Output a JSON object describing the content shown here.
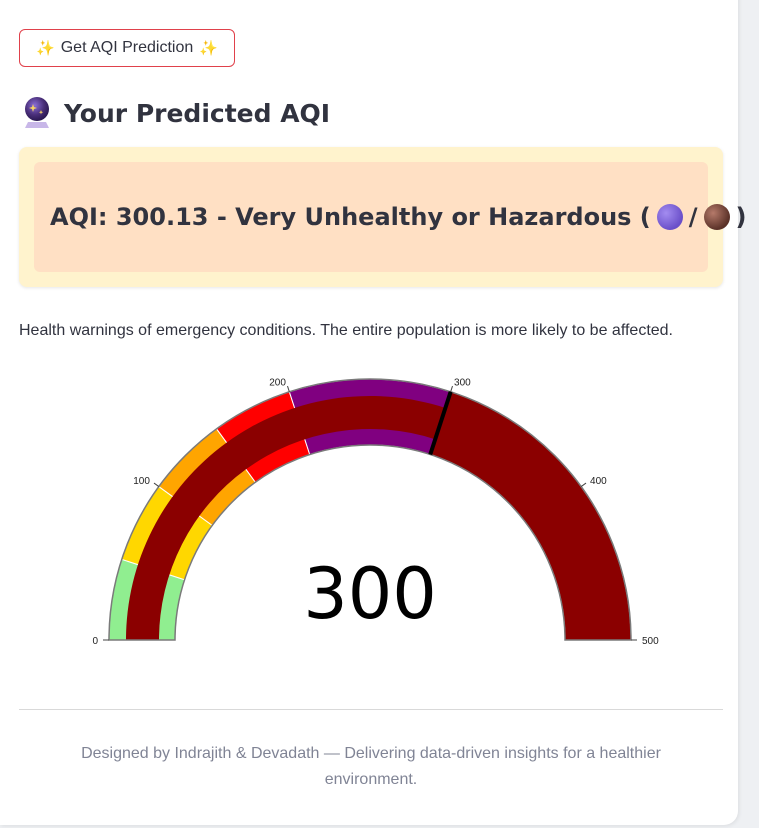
{
  "predict_button": {
    "label": "Get AQI Prediction",
    "icon": "sparkles-icon"
  },
  "heading": {
    "icon": "crystal-ball-icon",
    "text": "Your Predicted AQI"
  },
  "result": {
    "prefix": "AQI: 300.13 - Very Unhealthy or Hazardous (",
    "separator": "/",
    "suffix": ")",
    "colors": [
      "#7b61d9",
      "#6e3c30"
    ]
  },
  "warning_text": "Health warnings of emergency conditions. The entire population is more likely to be affected.",
  "chart_data": {
    "type": "gauge",
    "value": 300,
    "value_label": "300",
    "range": [
      0,
      500
    ],
    "ticks": [
      0,
      100,
      200,
      300,
      400,
      500
    ],
    "tick_labels": [
      "0",
      "100",
      "200",
      "300",
      "400",
      "500"
    ],
    "bar_color": "#8b0000",
    "steps": [
      {
        "range": [
          0,
          50
        ],
        "color": "#90ee90"
      },
      {
        "range": [
          50,
          100
        ],
        "color": "#ffd700"
      },
      {
        "range": [
          100,
          150
        ],
        "color": "#ffa500"
      },
      {
        "range": [
          150,
          200
        ],
        "color": "#ff0000"
      },
      {
        "range": [
          200,
          300
        ],
        "color": "#800080"
      },
      {
        "range": [
          300,
          500
        ],
        "color": "#8b0000"
      }
    ],
    "threshold": {
      "value": 300,
      "color": "#000000"
    }
  },
  "footer": {
    "line1": "Designed by Indrajith & Devadath — Delivering data-driven insights for a healthier",
    "line2": "environment."
  }
}
